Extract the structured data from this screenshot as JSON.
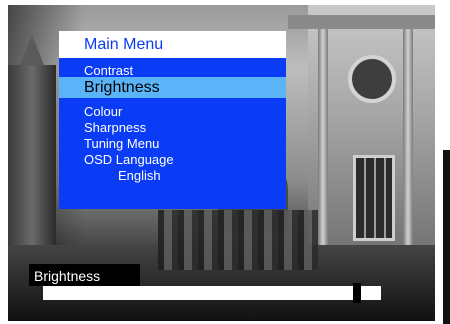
{
  "colors": {
    "menu_bg": "#0a3cf5",
    "title_bg": "#ffffff",
    "selected_bg": "#5ab4f7",
    "text": "#ffffff"
  },
  "menu": {
    "title": "Main Menu",
    "items": [
      {
        "label": "Contrast",
        "selected": false
      },
      {
        "label": "Brightness",
        "selected": true
      },
      {
        "label": "Colour",
        "selected": false
      },
      {
        "label": "Sharpness",
        "selected": false
      },
      {
        "label": "Tuning Menu",
        "selected": false
      },
      {
        "label": "OSD Language",
        "selected": false
      }
    ],
    "osd_language_value": "English"
  },
  "adjustment": {
    "label": "Brightness",
    "level_fraction": 0.93
  }
}
